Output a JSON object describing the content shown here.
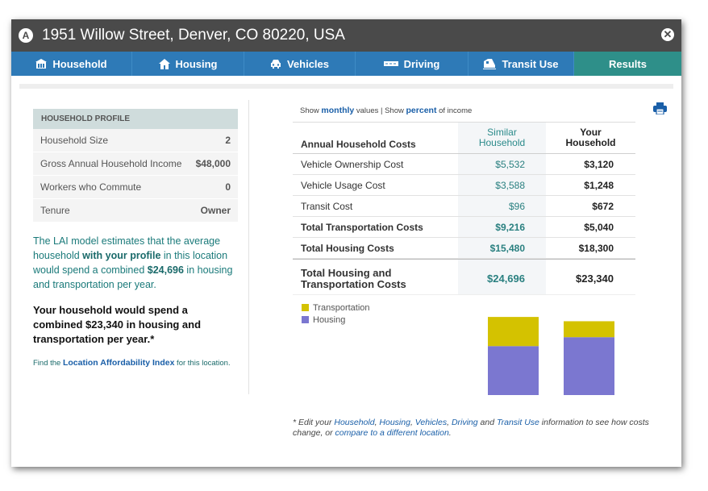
{
  "window": {
    "badge": "A",
    "title": "1951 Willow Street, Denver, CO 80220, USA",
    "close_icon": "close-icon"
  },
  "tabs": [
    {
      "label": "Household",
      "icon": "household-icon"
    },
    {
      "label": "Housing",
      "icon": "house-icon"
    },
    {
      "label": "Vehicles",
      "icon": "car-icon"
    },
    {
      "label": "Driving",
      "icon": "road-icon"
    },
    {
      "label": "Transit Use",
      "icon": "train-icon"
    },
    {
      "label": "Results",
      "icon": ""
    }
  ],
  "profile": {
    "header": "HOUSEHOLD PROFILE",
    "rows": [
      {
        "label": "Household Size",
        "value": "2"
      },
      {
        "label": "Gross Annual Household Income",
        "value": "$48,000"
      },
      {
        "label": "Workers who Commute",
        "value": "0"
      },
      {
        "label": "Tenure",
        "value": "Owner"
      }
    ]
  },
  "summary": {
    "p1_a": "The LAI model estimates that the average household ",
    "p1_b": "with your profile",
    "p1_c": " in this location would spend a combined ",
    "p1_d": "$24,696",
    "p1_e": " in housing and transportation per year.",
    "p2": "Your household would spend a combined $23,340 in housing and transportation per year.*",
    "find_prefix": "Find the ",
    "find_link": "Location Affordability Index",
    "find_suffix": " for this location."
  },
  "show": {
    "prefix": "Show ",
    "monthly": "monthly",
    "mid": " values | Show ",
    "percent": "percent",
    "suffix": " of income"
  },
  "table": {
    "col1": "Annual Household Costs",
    "col2_l1": "Similar",
    "col2_l2": "Household",
    "col3_l1": "Your",
    "col3_l2": "Household",
    "rows": [
      {
        "label": "Vehicle Ownership Cost",
        "similar": "$5,532",
        "yours": "$3,120"
      },
      {
        "label": "Vehicle Usage Cost",
        "similar": "$3,588",
        "yours": "$1,248"
      },
      {
        "label": "Transit Cost",
        "similar": "$96",
        "yours": "$672"
      },
      {
        "label": "Total Transportation Costs",
        "similar": "$9,216",
        "yours": "$5,040"
      },
      {
        "label": "Total Housing Costs",
        "similar": "$15,480",
        "yours": "$18,300"
      }
    ],
    "total_l1": "Total Housing and",
    "total_l2": "Transportation Costs",
    "total_similar": "$24,696",
    "total_yours": "$23,340"
  },
  "chart_data": {
    "type": "bar",
    "stacked": true,
    "categories": [
      "Similar Household",
      "Your Household"
    ],
    "series": [
      {
        "name": "Housing",
        "values": [
          15480,
          18300
        ],
        "color": "#7b77d0"
      },
      {
        "name": "Transportation",
        "values": [
          9216,
          5040
        ],
        "color": "#d4c200"
      }
    ],
    "legend": [
      "Transportation",
      "Housing"
    ],
    "legend_placement": "top-left",
    "ylim": [
      0,
      26000
    ],
    "grid": false
  },
  "footnote": {
    "pre": "* Edit your ",
    "l1": "Household",
    "s1": ", ",
    "l2": "Housing",
    "s2": ", ",
    "l3": "Vehicles",
    "s3": ", ",
    "l4": "Driving",
    "s4": " and ",
    "l5": "Transit Use",
    "s5": " information to see how costs change, or ",
    "l6": "compare to a different location",
    "s6": "."
  },
  "colors": {
    "tab_bar": "#2e7ab7",
    "tab_active": "#2e8f89",
    "accent_link": "#1a5fa8",
    "teal_text": "#1a7a7a"
  }
}
